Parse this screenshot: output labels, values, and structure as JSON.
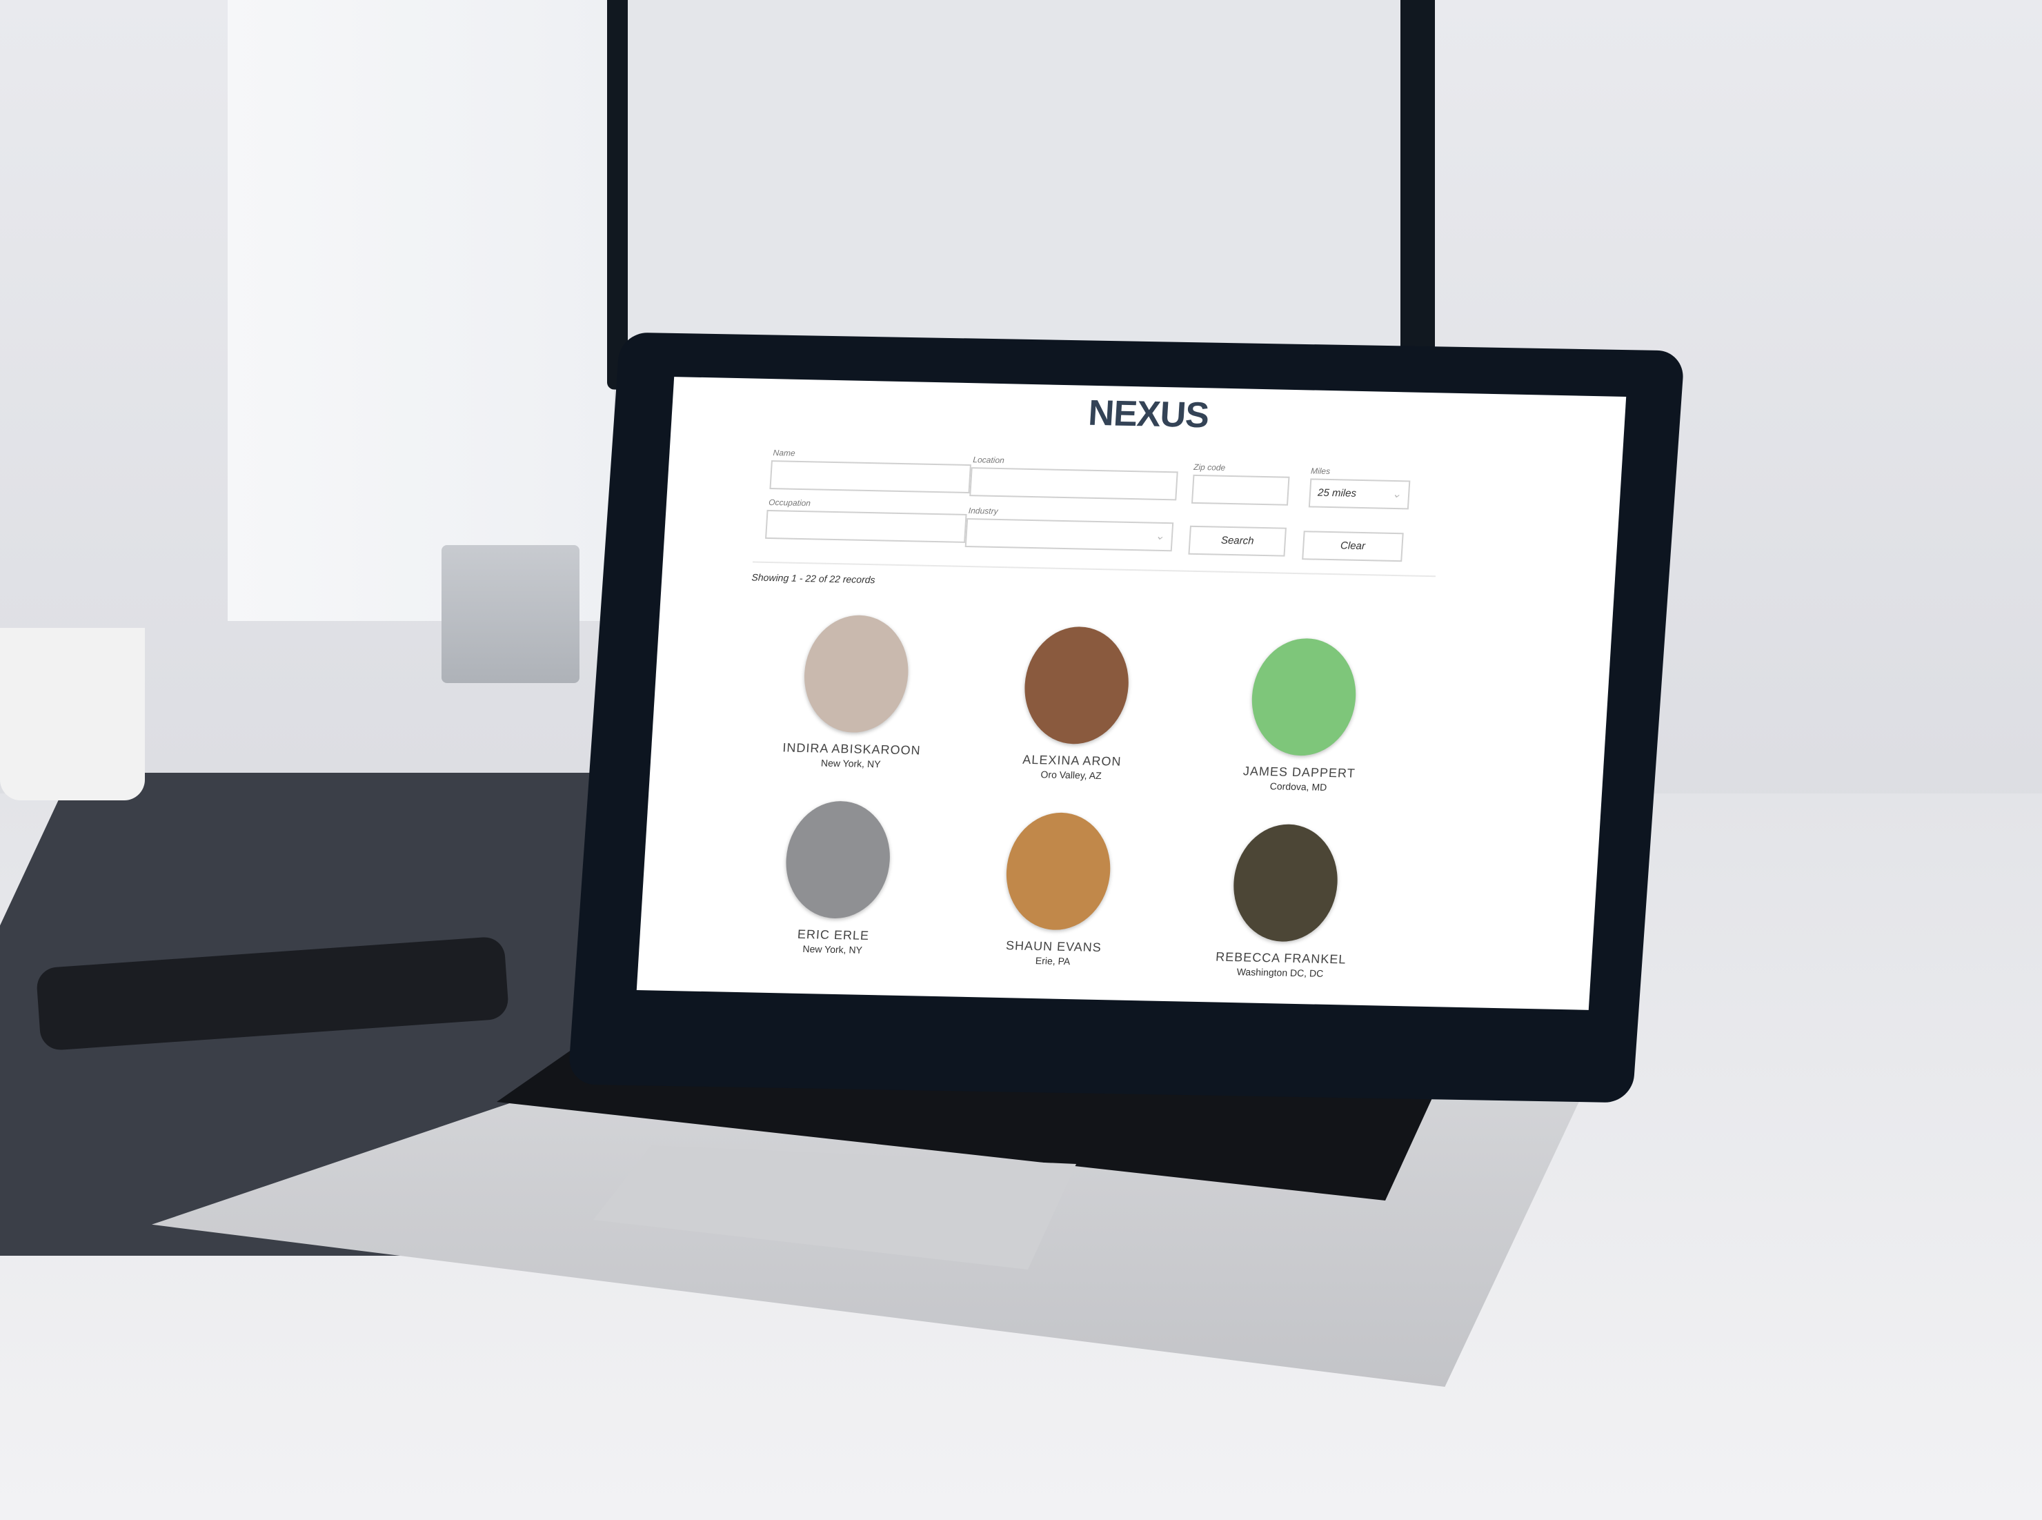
{
  "app": {
    "title": "NEXUS"
  },
  "form": {
    "name": {
      "label": "Name",
      "value": ""
    },
    "location": {
      "label": "Location",
      "value": ""
    },
    "zip": {
      "label": "Zip code",
      "value": ""
    },
    "miles": {
      "label": "Miles",
      "value": "25 miles"
    },
    "occupation": {
      "label": "Occupation",
      "value": ""
    },
    "industry": {
      "label": "Industry",
      "value": ""
    },
    "search_label": "Search",
    "clear_label": "Clear"
  },
  "results": {
    "summary": "Showing 1 - 22 of 22 records"
  },
  "people": [
    {
      "name": "INDIRA ABISKAROON",
      "location": "New York, NY",
      "color": "#c9b9ae"
    },
    {
      "name": "ALEXINA ARON",
      "location": "Oro Valley, AZ",
      "color": "#8a5a3e"
    },
    {
      "name": "JAMES DAPPERT",
      "location": "Cordova, MD",
      "color": "#7ec67a"
    },
    {
      "name": "ERIC ERLE",
      "location": "New York, NY",
      "color": "#8f9093"
    },
    {
      "name": "SHAUN EVANS",
      "location": "Erie, PA",
      "color": "#c1884a"
    },
    {
      "name": "REBECCA FRANKEL",
      "location": "Washington DC, DC",
      "color": "#4c4636"
    }
  ]
}
